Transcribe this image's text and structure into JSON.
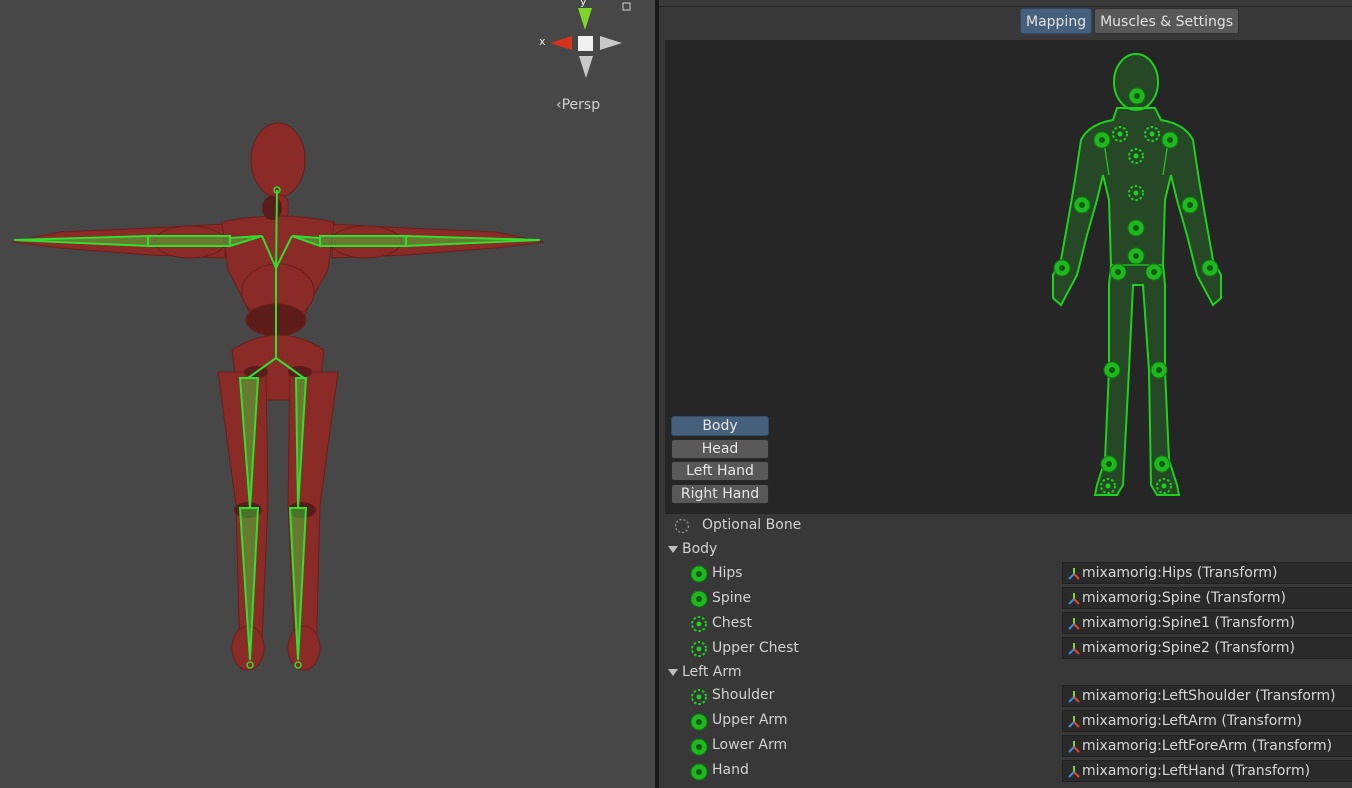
{
  "scene": {
    "gizmo": {
      "y_label": "y",
      "x_label": "x",
      "projection": "‹Persp"
    }
  },
  "inspector": {
    "tabs": [
      {
        "label": "Mapping",
        "active": true
      },
      {
        "label": "Muscles & Settings",
        "active": false
      }
    ],
    "modes": [
      {
        "label": "Body",
        "active": true
      },
      {
        "label": "Head",
        "active": false
      },
      {
        "label": "Left Hand",
        "active": false
      },
      {
        "label": "Right Hand",
        "active": false
      }
    ],
    "legend": {
      "icon": "dashed-circle-icon",
      "label": "Optional Bone"
    },
    "groups": [
      {
        "name": "Body",
        "expanded": true,
        "bones": [
          {
            "name": "Hips",
            "optional": false,
            "value": "mixamorig:Hips (Transform)"
          },
          {
            "name": "Spine",
            "optional": false,
            "value": "mixamorig:Spine (Transform)"
          },
          {
            "name": "Chest",
            "optional": true,
            "value": "mixamorig:Spine1 (Transform)"
          },
          {
            "name": "Upper Chest",
            "optional": true,
            "value": "mixamorig:Spine2 (Transform)"
          }
        ]
      },
      {
        "name": "Left Arm",
        "expanded": true,
        "bones": [
          {
            "name": "Shoulder",
            "optional": true,
            "value": "mixamorig:LeftShoulder (Transform)"
          },
          {
            "name": "Upper Arm",
            "optional": false,
            "value": "mixamorig:LeftArm (Transform)"
          },
          {
            "name": "Lower Arm",
            "optional": false,
            "value": "mixamorig:LeftForeArm (Transform)"
          },
          {
            "name": "Hand",
            "optional": false,
            "value": "mixamorig:LeftHand (Transform)"
          }
        ]
      }
    ],
    "colors": {
      "bone_green": "#1fd11f",
      "active_blue": "#46607c",
      "model_red": "#8a2b27"
    }
  }
}
